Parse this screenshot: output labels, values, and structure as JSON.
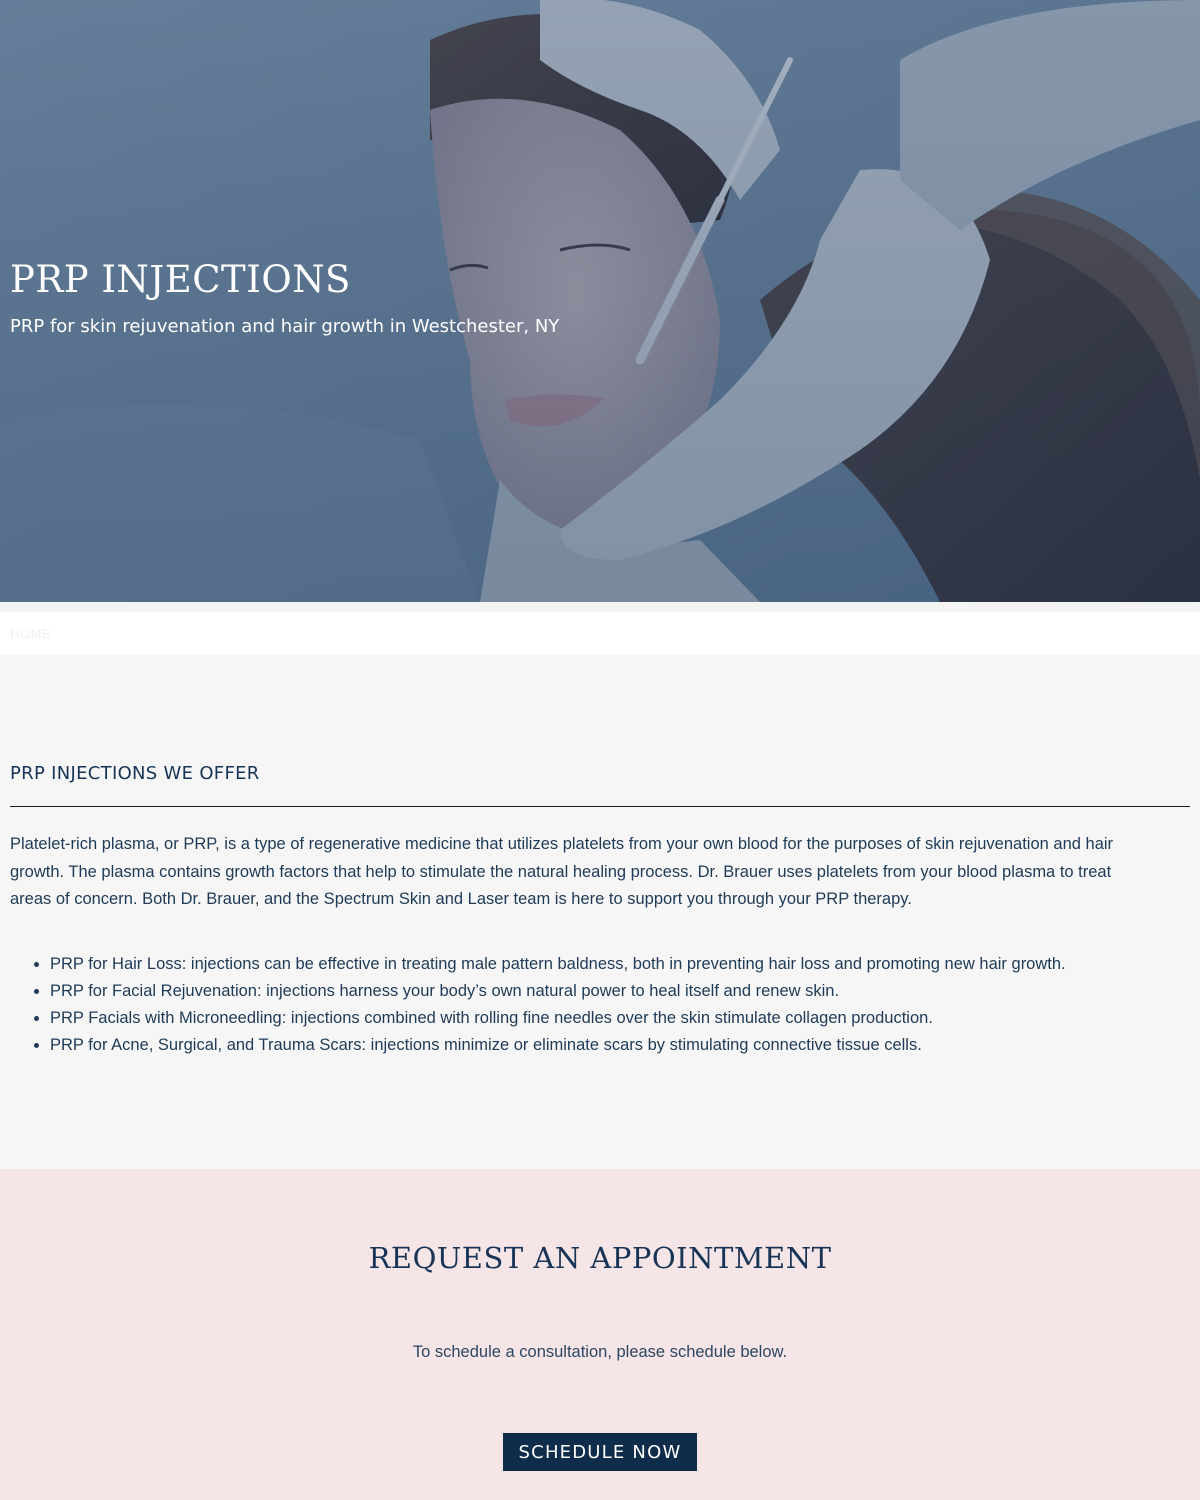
{
  "hero": {
    "title": "PRP INJECTIONS",
    "subtitle": "PRP for skin rejuvenation and hair growth in Westchester, NY"
  },
  "breadcrumb": {
    "home": "HOME"
  },
  "offer": {
    "title": "PRP INJECTIONS WE OFFER",
    "intro": "Platelet-rich plasma, or PRP, is a type of regenerative medicine that utilizes platelets from your own blood for the purposes of skin rejuvenation and hair growth. The plasma contains growth factors that help to stimulate the natural healing process. Dr. Brauer uses platelets from your blood plasma to treat areas of concern. Both Dr. Brauer, and the Spectrum Skin and Laser team is here to support you through your PRP therapy.",
    "items": [
      "PRP for Hair Loss: injections can be effective in treating male pattern baldness, both in preventing hair loss and promoting new hair growth.",
      "PRP for Facial Rejuvenation: injections harness your body’s own natural power to heal itself and renew skin.",
      "PRP Facials with Microneedling: injections combined with rolling fine needles over the skin stimulate collagen production.",
      "PRP for Acne, Surgical, and Trauma Scars: injections minimize or eliminate scars by stimulating connective tissue cells."
    ]
  },
  "appointment": {
    "title": "REQUEST AN APPOINTMENT",
    "text": "To schedule a consultation, please schedule below.",
    "button_label": "SCHEDULE NOW"
  },
  "colors": {
    "navy": "#0f2c4a",
    "heading": "#173456",
    "body_text": "#1e3a56",
    "appointment_bg": "#f5e5e6",
    "section_bg": "#f6f6f6"
  }
}
